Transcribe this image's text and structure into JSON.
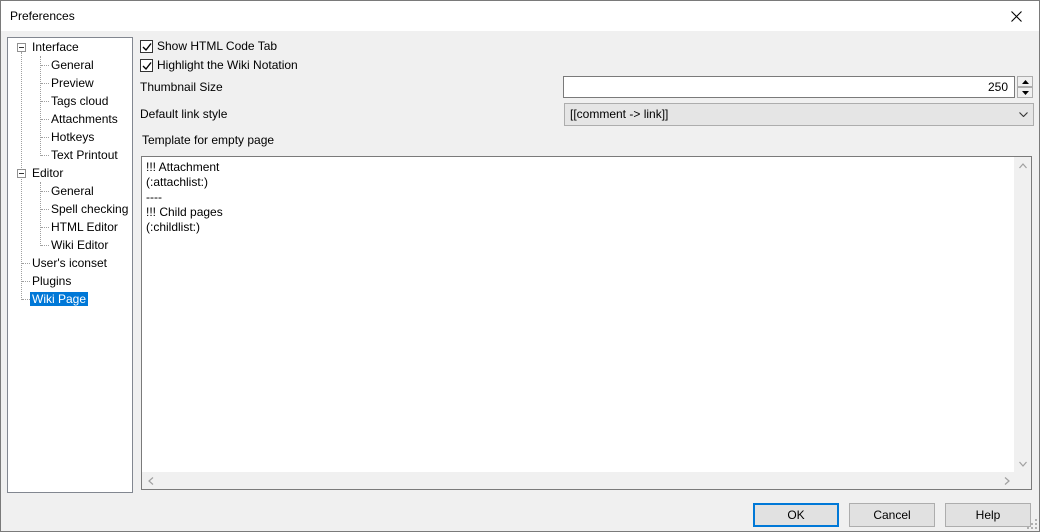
{
  "window": {
    "title": "Preferences"
  },
  "tree": {
    "items": [
      {
        "label": "Interface",
        "level": 0,
        "expanded": true
      },
      {
        "label": "General",
        "level": 1
      },
      {
        "label": "Preview",
        "level": 1
      },
      {
        "label": "Tags cloud",
        "level": 1
      },
      {
        "label": "Attachments",
        "level": 1
      },
      {
        "label": "Hotkeys",
        "level": 1
      },
      {
        "label": "Text Printout",
        "level": 1
      },
      {
        "label": "Editor",
        "level": 0,
        "expanded": true
      },
      {
        "label": "General",
        "level": 1
      },
      {
        "label": "Spell checking",
        "level": 1
      },
      {
        "label": "HTML Editor",
        "level": 1
      },
      {
        "label": "Wiki Editor",
        "level": 1
      },
      {
        "label": "User's iconset",
        "level": 0
      },
      {
        "label": "Plugins",
        "level": 0
      },
      {
        "label": "Wiki Page",
        "level": 0,
        "selected": true
      }
    ]
  },
  "settings": {
    "show_html_tab": {
      "label": "Show HTML Code Tab",
      "checked": true
    },
    "highlight_wiki": {
      "label": "Highlight the Wiki Notation",
      "checked": true
    },
    "thumbnail": {
      "label": "Thumbnail Size",
      "value": "250"
    },
    "link_style": {
      "label": "Default link style",
      "selected": "[[comment -> link]]"
    },
    "template": {
      "label": "Template for empty page",
      "lines": [
        "!!! Attachment",
        "(:attachlist:)",
        "----",
        "!!! Child pages",
        "(:childlist:)"
      ]
    }
  },
  "buttons": {
    "ok": "OK",
    "cancel": "Cancel",
    "help": "Help"
  },
  "colors": {
    "selection": "#0078d7",
    "default_border": "#0078d7"
  }
}
